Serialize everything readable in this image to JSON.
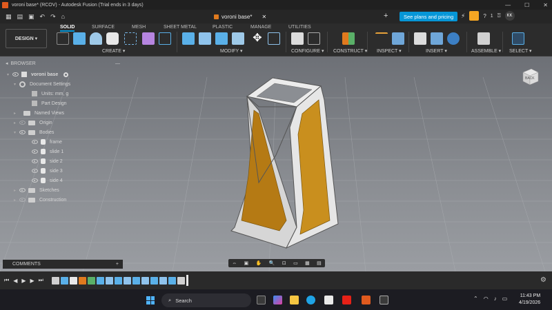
{
  "titlebar": {
    "title": "voroni base* (RCOV) - Autodesk Fusion (Trial ends in 3 days)",
    "controls": [
      "—",
      "☐",
      "✕"
    ]
  },
  "tabbar": {
    "doc_title": "voroni base*",
    "doc_close": "✕",
    "new_tab": "+",
    "plans_button": "See plans and pricing",
    "notifications": "1",
    "user_initials": "KK"
  },
  "toolbar": {
    "design_label": "DESIGN ▾",
    "workspace_tabs": [
      "SOLID",
      "SURFACE",
      "MESH",
      "SHEET METAL",
      "PLASTIC",
      "MANAGE",
      "UTILITIES"
    ],
    "active_tab": "SOLID",
    "groups": {
      "create": "CREATE ▾",
      "modify": "MODIFY ▾",
      "configure": "CONFIGURE ▾",
      "construct": "CONSTRUCT ▾",
      "inspect": "INSPECT ▾",
      "insert": "INSERT ▾",
      "assemble": "ASSEMBLE ▾",
      "select": "SELECT ▾"
    }
  },
  "browser": {
    "header": "BROWSER",
    "items": [
      {
        "label": "voroni base",
        "depth": 0,
        "type": "root"
      },
      {
        "label": "Document Settings",
        "depth": 1,
        "type": "settings"
      },
      {
        "label": "Units: mm, g",
        "depth": 2,
        "type": "units"
      },
      {
        "label": "Part Design",
        "depth": 2,
        "type": "part"
      },
      {
        "label": "Named Views",
        "depth": 1,
        "type": "folder"
      },
      {
        "label": "Origin",
        "depth": 1,
        "type": "folder"
      },
      {
        "label": "Bodies",
        "depth": 1,
        "type": "folder"
      },
      {
        "label": "frame",
        "depth": 2,
        "type": "body"
      },
      {
        "label": "slide 1",
        "depth": 2,
        "type": "body"
      },
      {
        "label": "side 2",
        "depth": 2,
        "type": "body"
      },
      {
        "label": "side 3",
        "depth": 2,
        "type": "body"
      },
      {
        "label": "side 4",
        "depth": 2,
        "type": "body"
      },
      {
        "label": "Sketches",
        "depth": 1,
        "type": "folder"
      },
      {
        "label": "Construction",
        "depth": 1,
        "type": "folder"
      }
    ]
  },
  "comments": {
    "label": "COMMENTS"
  },
  "viewcube": {
    "label": "BACK"
  },
  "taskbar": {
    "search_placeholder": "Search",
    "time": "11:43 PM",
    "date": "4/19/2026"
  },
  "colors": {
    "accent": "#0696d7",
    "model_panel": "#c98f1e",
    "frame": "#e3e3e3",
    "viewport_top": "#6d7076"
  }
}
